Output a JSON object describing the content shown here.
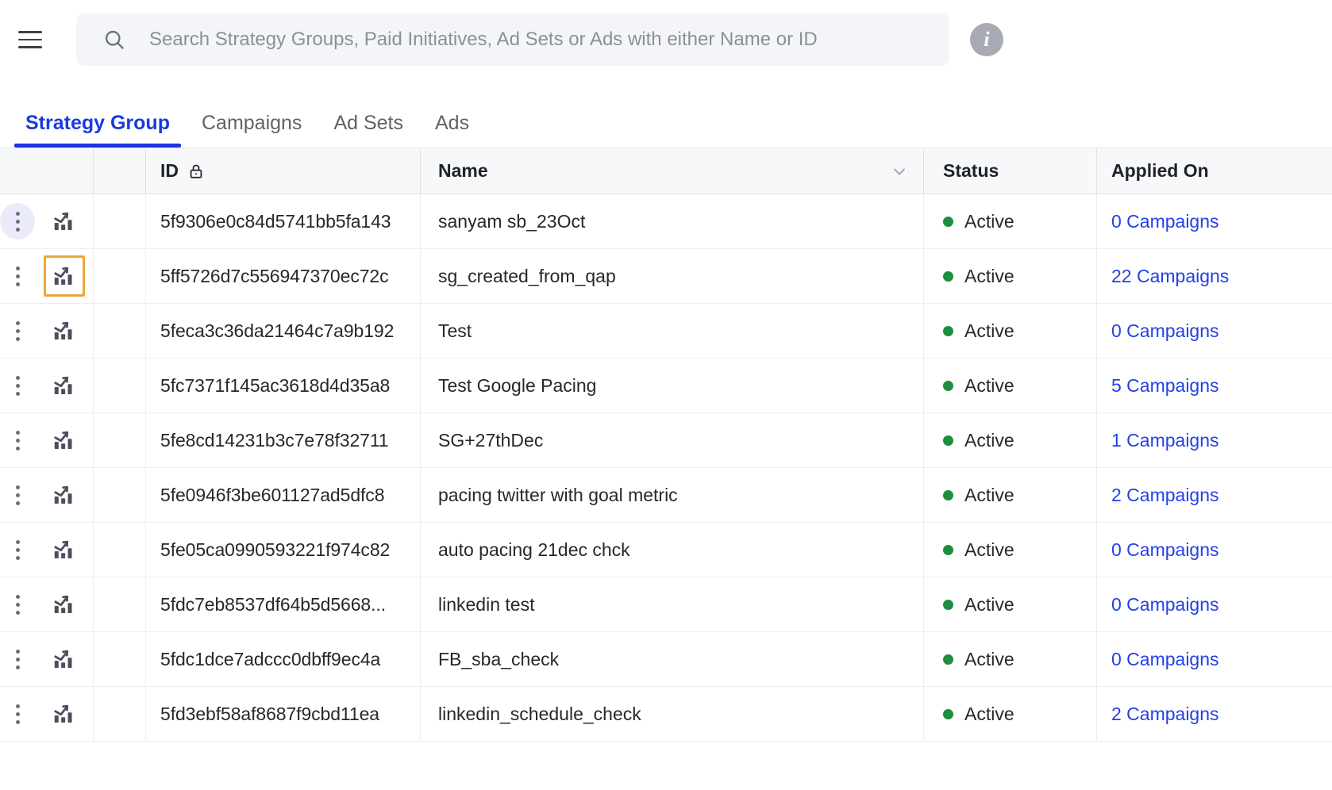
{
  "colors": {
    "accent": "#1a35e0",
    "link": "#2340e8",
    "status_active": "#1e8e3e",
    "focus_outline": "#eda63b",
    "hover_bg": "#eaeafb",
    "header_bg": "#f7f8fa",
    "search_bg": "#f4f5f8"
  },
  "topbar": {
    "menu_icon": "hamburger-icon",
    "search": {
      "icon": "search-icon",
      "placeholder": "Search Strategy Groups, Paid Initiatives, Ad Sets or Ads with either Name or ID",
      "value": ""
    },
    "info_icon_label": "i"
  },
  "tabs": [
    {
      "label": "Strategy Group",
      "active": true
    },
    {
      "label": "Campaigns",
      "active": false
    },
    {
      "label": "Ad Sets",
      "active": false
    },
    {
      "label": "Ads",
      "active": false
    }
  ],
  "table": {
    "columns": {
      "id": "ID",
      "id_icon": "lock-icon",
      "name": "Name",
      "name_sort_icon": "chevron-down-icon",
      "status": "Status",
      "applied_on": "Applied On"
    },
    "row_icons": {
      "kebab": "kebab-menu-icon",
      "chart": "bar-chart-trend-icon"
    },
    "rows": [
      {
        "id": "5f9306e0c84d5741bb5fa143",
        "name": "sanyam sb_23Oct",
        "status": "Active",
        "applied_on": "0 Campaigns",
        "kebab_hovered": true,
        "chart_focused": false
      },
      {
        "id": "5ff5726d7c556947370ec72c",
        "name": "sg_created_from_qap",
        "status": "Active",
        "applied_on": "22 Campaigns",
        "kebab_hovered": false,
        "chart_focused": true
      },
      {
        "id": "5feca3c36da21464c7a9b192",
        "name": "Test",
        "status": "Active",
        "applied_on": "0 Campaigns",
        "kebab_hovered": false,
        "chart_focused": false
      },
      {
        "id": "5fc7371f145ac3618d4d35a8",
        "name": "Test Google Pacing",
        "status": "Active",
        "applied_on": "5 Campaigns",
        "kebab_hovered": false,
        "chart_focused": false
      },
      {
        "id": "5fe8cd14231b3c7e78f32711",
        "name": "SG+27thDec",
        "status": "Active",
        "applied_on": "1 Campaigns",
        "kebab_hovered": false,
        "chart_focused": false
      },
      {
        "id": "5fe0946f3be601127ad5dfc8",
        "name": "pacing twitter with goal metric",
        "status": "Active",
        "applied_on": "2 Campaigns",
        "kebab_hovered": false,
        "chart_focused": false
      },
      {
        "id": "5fe05ca0990593221f974c82",
        "name": "auto pacing 21dec chck",
        "status": "Active",
        "applied_on": "0 Campaigns",
        "kebab_hovered": false,
        "chart_focused": false
      },
      {
        "id": "5fdc7eb8537df64b5d5668...",
        "name": "linkedin test",
        "status": "Active",
        "applied_on": "0 Campaigns",
        "kebab_hovered": false,
        "chart_focused": false
      },
      {
        "id": "5fdc1dce7adccc0dbff9ec4a",
        "name": "FB_sba_check",
        "status": "Active",
        "applied_on": "0 Campaigns",
        "kebab_hovered": false,
        "chart_focused": false
      },
      {
        "id": "5fd3ebf58af8687f9cbd11ea",
        "name": "linkedin_schedule_check",
        "status": "Active",
        "applied_on": "2 Campaigns",
        "kebab_hovered": false,
        "chart_focused": false
      }
    ]
  }
}
